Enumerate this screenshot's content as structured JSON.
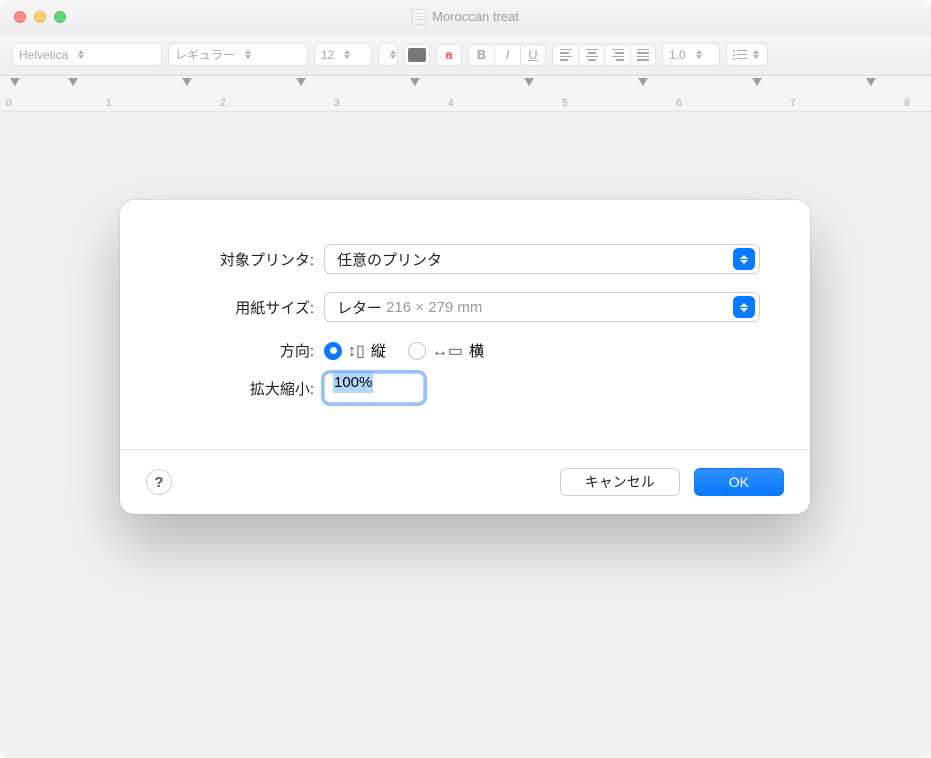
{
  "window": {
    "title": "Moroccan treat"
  },
  "toolbar": {
    "font_family": "Helvetica",
    "font_style": "レギュラー",
    "font_size": "12",
    "line_spacing": "1.0"
  },
  "ruler": {
    "numbers": [
      "0",
      "1",
      "2",
      "3",
      "4",
      "5",
      "6",
      "7",
      "8"
    ]
  },
  "dialog": {
    "printer_label": "対象プリンタ:",
    "printer_value": "任意のプリンタ",
    "paper_label": "用紙サイズ:",
    "paper_value": "レター",
    "paper_dims": "216 × 279 mm",
    "orientation_label": "方向:",
    "orientation_portrait": "縦",
    "orientation_landscape": "横",
    "scale_label": "拡大縮小:",
    "scale_value": "100%",
    "help_label": "?",
    "cancel_label": "キャンセル",
    "ok_label": "OK"
  }
}
